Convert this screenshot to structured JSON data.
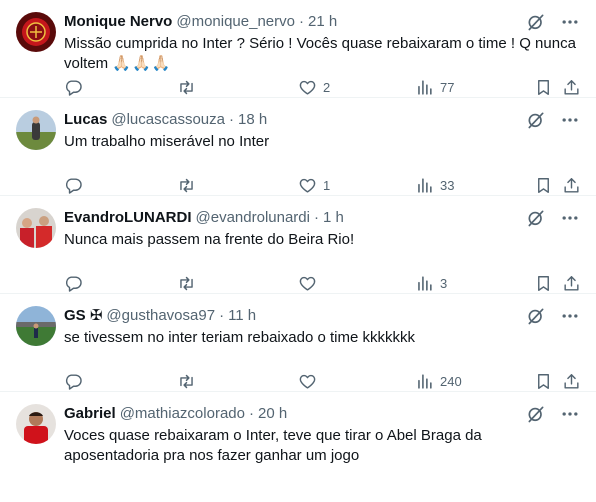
{
  "tweets": [
    {
      "name": "Monique Nervo",
      "handle": "@monique_nervo",
      "time": "21 h",
      "text": "Missão cumprida no Inter ? Sério ! Vocês quase rebaixaram o time ! Q nunca voltem",
      "emoji": "🙏🏻🙏🏻🙏🏻",
      "replies": "",
      "retweets": "",
      "likes": "2",
      "views": "77"
    },
    {
      "name": "Lucas",
      "handle": "@lucascassouza",
      "time": "18 h",
      "text": "Um trabalho miserável no Inter",
      "replies": "",
      "retweets": "",
      "likes": "1",
      "views": "33"
    },
    {
      "name": "EvandroLUNARDI",
      "handle": "@evandrolunardi",
      "time": "1 h",
      "text": "Nunca mais passem na frente do Beira Rio!",
      "replies": "",
      "retweets": "",
      "likes": "",
      "views": "3"
    },
    {
      "name": "GS ✠",
      "handle": "@gusthavosa97",
      "time": "11 h",
      "text": "se tivessem no inter teriam rebaixado o time kkkkkkk",
      "replies": "",
      "retweets": "",
      "likes": "",
      "views": "240"
    },
    {
      "name": "Gabriel",
      "handle": "@mathiazcolorado",
      "time": "20 h",
      "text": "Voces quase rebaixaram o Inter, teve que tirar o Abel Braga da aposentadoria pra nos fazer ganhar um jogo"
    }
  ],
  "separator": "·",
  "icons": {
    "grok": "grok-icon",
    "more": "more-icon",
    "reply": "reply-icon",
    "retweet": "retweet-icon",
    "like": "heart-icon",
    "views": "views-icon",
    "bookmark": "bookmark-icon",
    "share": "share-icon"
  },
  "colors": {
    "text": "#0f1419",
    "muted": "#536471",
    "border": "#eff3f4"
  }
}
